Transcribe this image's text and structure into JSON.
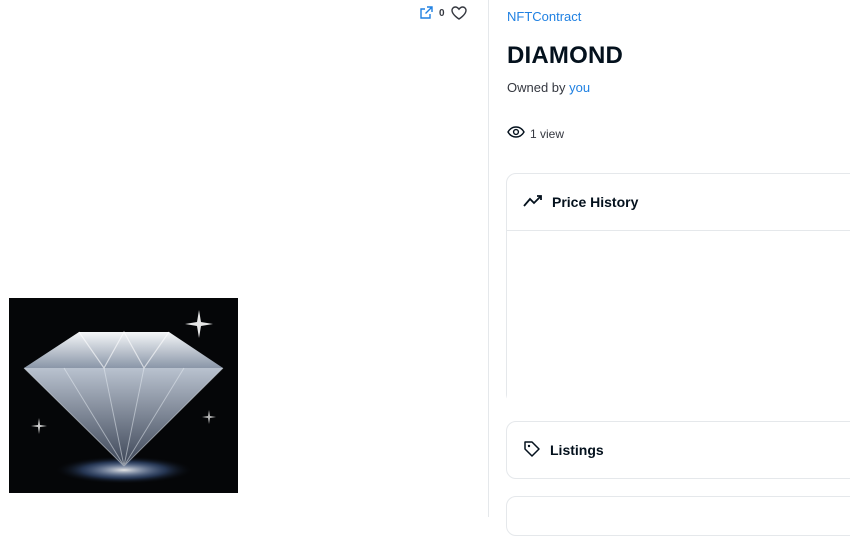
{
  "nft": {
    "collection": "NFTContract",
    "title": "DIAMOND",
    "owner_prefix": "Owned by",
    "owner_name": "you",
    "views": "1 view",
    "favorites": "0"
  },
  "panels": {
    "price_history": "Price History",
    "listings": "Listings"
  },
  "icons": {
    "external": "external-link-icon",
    "heart": "heart-icon",
    "eye": "eye-icon",
    "trend": "trend-line-icon",
    "tag": "tag-icon"
  },
  "colors": {
    "link": "#2081e2",
    "text": "#04111d",
    "border": "#e5e8eb"
  }
}
